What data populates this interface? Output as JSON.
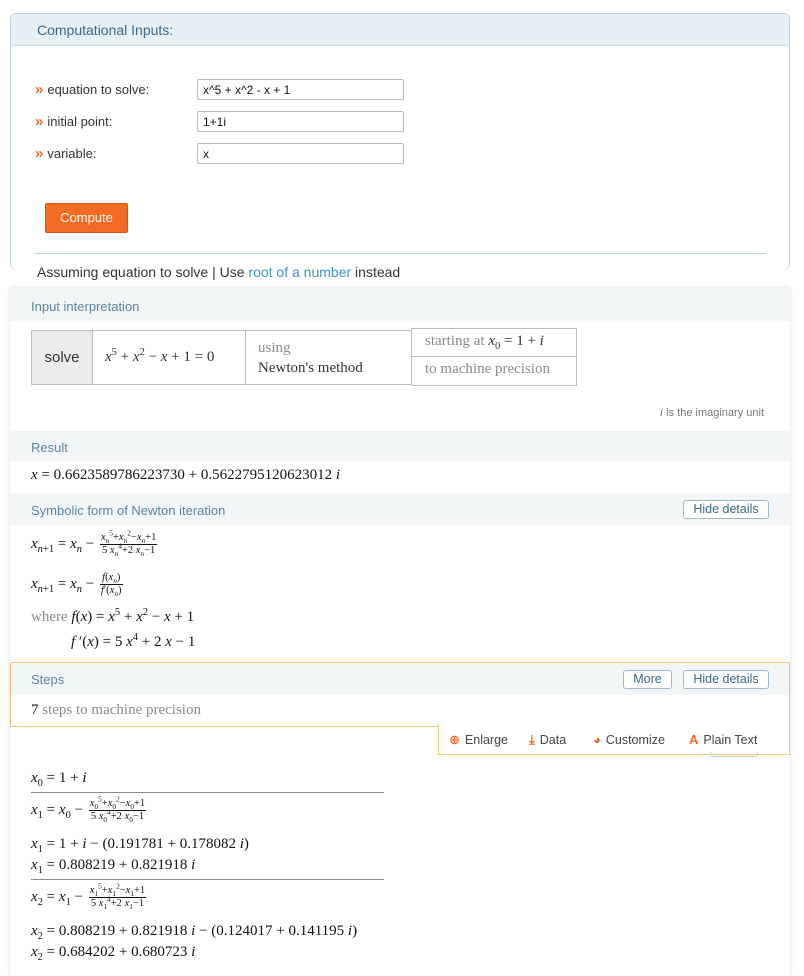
{
  "inputs": {
    "header": "Computational Inputs:",
    "fields": [
      {
        "label": "equation to solve:",
        "value": "x^5 + x^2 - x + 1"
      },
      {
        "label": "initial point:",
        "value": "1+1i"
      },
      {
        "label": "variable:",
        "value": "x"
      }
    ],
    "compute_label": "Compute",
    "assuming_prefix": "Assuming equation to solve | Use ",
    "assuming_link": "root of a number",
    "assuming_suffix": " instead"
  },
  "interpretation": {
    "title": "Input interpretation",
    "solve": "solve",
    "using": "using",
    "method": "Newton's method",
    "starting_at": "starting at",
    "precision": "to machine precision",
    "imag_note": "is the imaginary unit"
  },
  "result": {
    "title": "Result",
    "real": "0.6623589786223730",
    "imag": "0.5622795120623012"
  },
  "symbolic": {
    "title": "Symbolic form of Newton iteration",
    "hide_label": "Hide details",
    "where": "where"
  },
  "steps": {
    "title": "Steps",
    "more_label": "More",
    "hide_label": "Hide details",
    "count": "7",
    "count_text": "steps to machine precision"
  },
  "toolbar": {
    "enlarge": "Enlarge",
    "data": "Data",
    "customize": "Customize",
    "plain_text": "Plain Text"
  },
  "iterations": {
    "x1_correction": "(0.191781 + 0.178082",
    "x1_real": "0.808219",
    "x1_imag": "0.821918",
    "x2_correction": "(0.124017 + 0.141195",
    "x2_real": "0.684202",
    "x2_imag": "0.680723"
  },
  "colors": {
    "accent": "#f26b22",
    "link": "#3b95c4",
    "pod_title": "#5a85a0",
    "steps_border": "#f6c978"
  }
}
